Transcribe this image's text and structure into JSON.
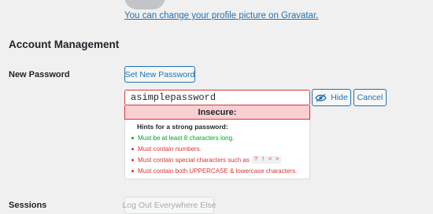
{
  "profile": {
    "gravatar_link": "You can change your profile picture on Gravatar",
    "gravatar_period": "."
  },
  "account": {
    "section_title": "Account Management",
    "new_password_label": "New Password",
    "set_password_button": "Set New Password",
    "password_value": "asimplepassword",
    "hide_button": "Hide",
    "cancel_button": "Cancel",
    "strength": "Insecure:",
    "hints": {
      "title": "Hints for a strong password:",
      "items": [
        {
          "text": "Must be at least 8 characters long.",
          "status": "ok"
        },
        {
          "text": "Must contain numbers.",
          "status": "bad"
        },
        {
          "text": "Must contain special characters such as",
          "status": "bad",
          "code": "? ! < >"
        },
        {
          "text": "Must contain both UPPERCASE & lowercase characters.",
          "status": "bad"
        }
      ]
    }
  },
  "sessions": {
    "label": "Sessions",
    "logout_button": "Log Out Everywhere Else"
  },
  "colors": {
    "link": "#2271b1",
    "error": "#d63638",
    "success": "#00a32a",
    "strength_bg": "#facfd2",
    "page_bg": "#f0f0f1"
  },
  "icons": {
    "hide": "eye-slash-icon"
  }
}
